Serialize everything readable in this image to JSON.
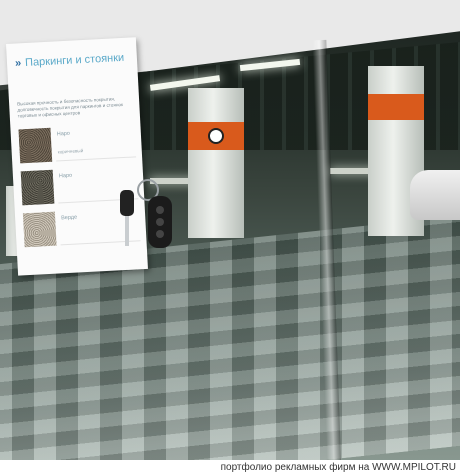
{
  "panel": {
    "title": "Паркинги и стоянки",
    "description": "Высокая прочность и безопасность покрытия, долговечность покрытия для паркингов и стоянок торговых и офисных центров",
    "items": [
      {
        "label": "Наро",
        "sublabel": "коричневый",
        "swatch_color": "#6a5d4e"
      },
      {
        "label": "Наро",
        "sublabel": "",
        "swatch_color": "#565449"
      },
      {
        "label": "Верде",
        "sublabel": "",
        "swatch_color": "#b8b0a2"
      }
    ]
  },
  "footer": {
    "caption_prefix": "портфолио рекламных фирм на ",
    "caption_site": "WWW.MPILOT.RU"
  },
  "colors": {
    "accent_band": "#d95a1c",
    "title_blue": "#5aa9c9"
  }
}
